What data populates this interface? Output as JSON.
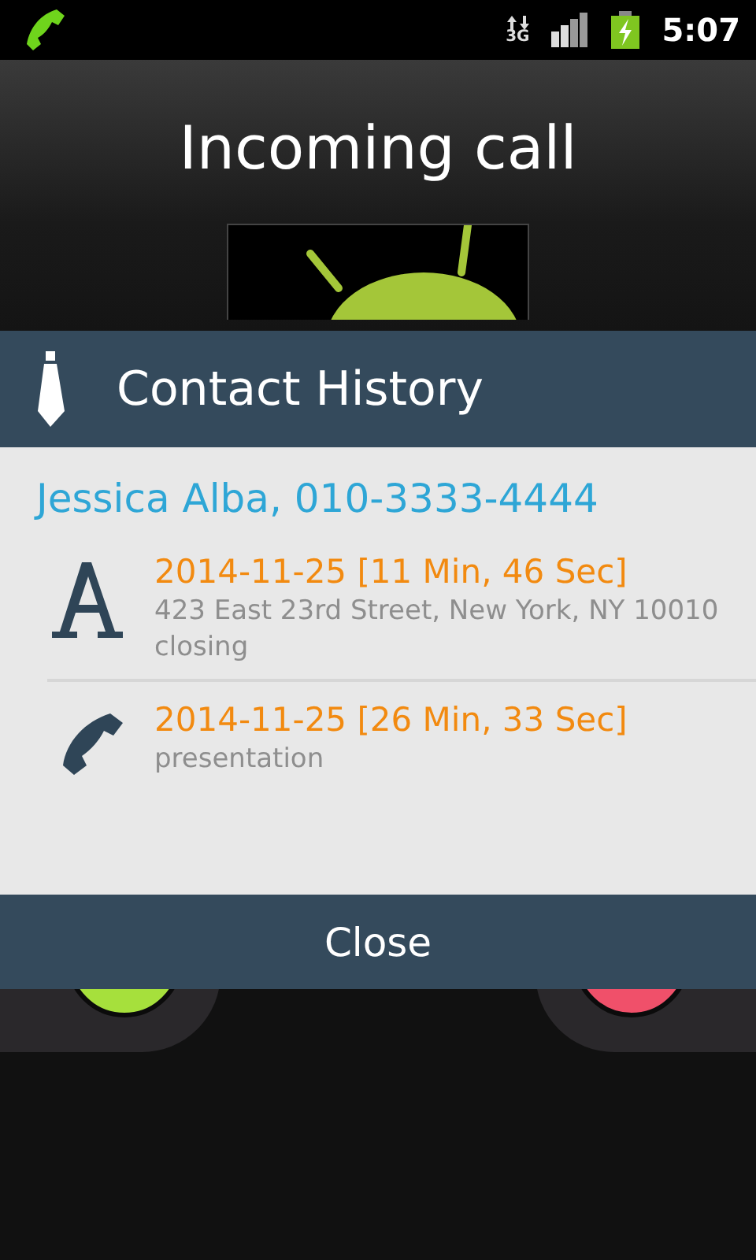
{
  "status_bar": {
    "network": "3G",
    "time": "5:07"
  },
  "title": "Incoming call",
  "dialog": {
    "title": "Contact History",
    "contact": "Jessica Alba, 010-3333-4444",
    "entries": [
      {
        "kind": "note",
        "date": "2014-11-25 [11 Min, 46 Sec]",
        "details": [
          "423 East 23rd Street, New York, NY 10010",
          "closing"
        ]
      },
      {
        "kind": "call",
        "date": "2014-11-25 [26 Min, 33 Sec]",
        "details": [
          "presentation"
        ]
      }
    ],
    "button": "Close"
  }
}
